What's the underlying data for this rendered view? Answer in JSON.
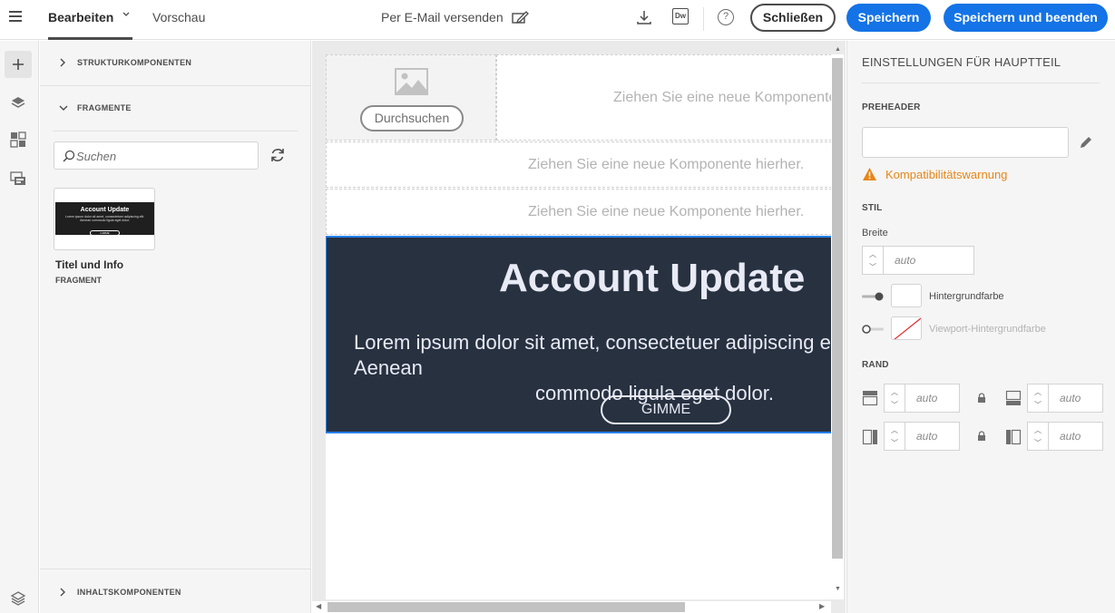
{
  "topbar": {
    "tab_edit": "Bearbeiten",
    "tab_preview": "Vorschau",
    "send_email": "Per E-Mail versenden",
    "dw_badge": "Dw",
    "help_glyph": "?",
    "close_label": "Schließen",
    "save_label": "Speichern",
    "save_close_label": "Speichern und beenden",
    "accent_color": "#1473e6"
  },
  "components_panel": {
    "structure_label": "STRUKTURKOMPONENTEN",
    "fragments_label": "FRAGMENTE",
    "search_placeholder": "Suchen",
    "fragment": {
      "thumb_title": "Account Update",
      "thumb_body": "Lorem ipsum dolor sit amet, consectetuer adipiscing elit. Aenean commodo ligula eget dolor.",
      "thumb_button": "GIMME",
      "title": "Titel und Info",
      "type": "FRAGMENT"
    },
    "content_label": "INHALTSKOMPONENTEN"
  },
  "canvas": {
    "browse_label": "Durchsuchen",
    "drop_text": "Ziehen Sie eine neue Komponente hierher.",
    "hero": {
      "title": "Account Update",
      "body_line1": "Lorem ipsum dolor sit amet, consectetuer adipiscing elit. Aenean",
      "body_line2": "commodo ligula eget dolor.",
      "button": "GIMME",
      "bg_color": "#273140",
      "selection_color": "#2680eb"
    }
  },
  "settings": {
    "title": "EINSTELLUNGEN FÜR HAUPTTEIL",
    "preheader_label": "PREHEADER",
    "warning": "Kompatibilitätswarnung",
    "warning_color": "#e68619",
    "style_label": "STIL",
    "width_label": "Breite",
    "width_value": "auto",
    "bg_color_label": "Hintergrundfarbe",
    "viewport_bg_label": "Viewport-Hintergrundfarbe",
    "margin_label": "RAND",
    "margin_top": "auto",
    "margin_bottom": "auto",
    "margin_left": "auto",
    "margin_right": "auto"
  }
}
